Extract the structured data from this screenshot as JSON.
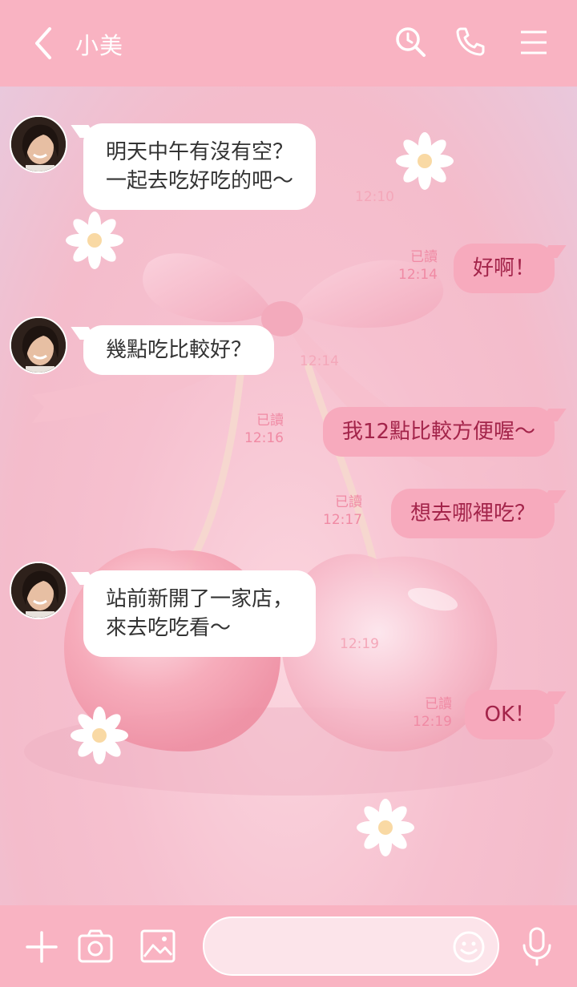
{
  "header": {
    "title": "小美"
  },
  "messages": [
    {
      "side": "in",
      "text": "明天中午有沒有空？\n一起去吃好吃的吧〜",
      "time": "12:10"
    },
    {
      "side": "out",
      "text": "好啊！",
      "read": "已讀",
      "time": "12:14"
    },
    {
      "side": "in",
      "text": "幾點吃比較好？",
      "time": "12:14"
    },
    {
      "side": "out",
      "text": "我12點比較方便喔〜",
      "read": "已讀",
      "time": "12:16"
    },
    {
      "side": "out",
      "text": "想去哪裡吃？",
      "read": "已讀",
      "time": "12:17"
    },
    {
      "side": "in",
      "text": "站前新開了一家店，\n來去吃吃看〜",
      "time": "12:19"
    },
    {
      "side": "out",
      "text": "OK！",
      "read": "已讀",
      "time": "12:19"
    }
  ],
  "input": {
    "placeholder": ""
  },
  "icons": {
    "back": "chevron-left-icon",
    "search": "search-clock-icon",
    "call": "phone-icon",
    "menu": "menu-icon",
    "add": "plus-icon",
    "camera": "camera-icon",
    "image": "image-icon",
    "emoji": "smile-icon",
    "mic": "mic-icon"
  },
  "colors": {
    "header": "#f9b3c2",
    "outgoing_bubble": "#f7aabd",
    "outgoing_text": "#a3244a",
    "incoming_bubble": "#ffffff"
  }
}
